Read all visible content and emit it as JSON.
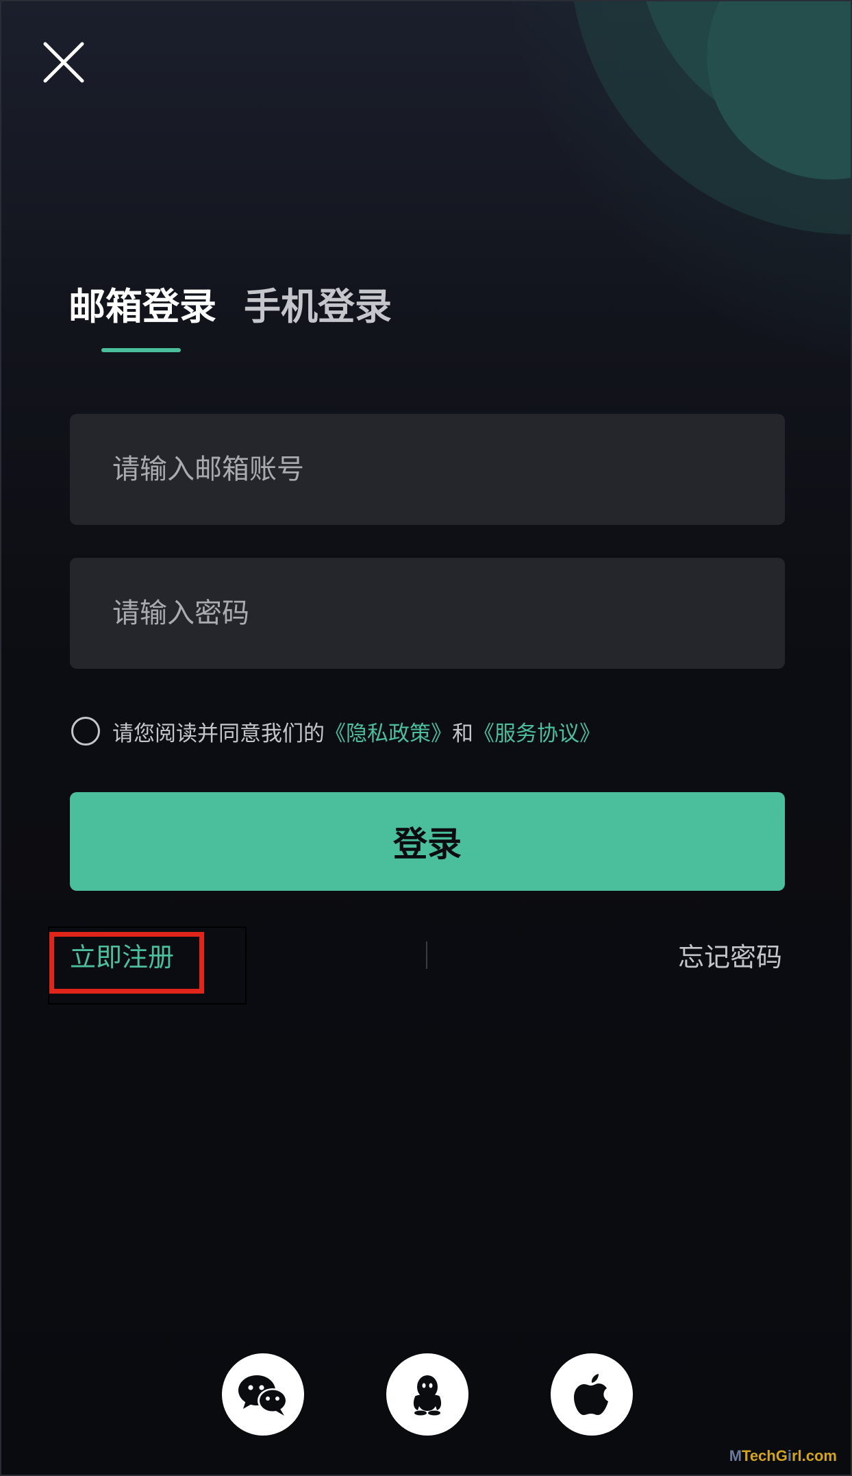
{
  "colors": {
    "accent": "#4bbf9c",
    "background": "#0b0c10",
    "field_background": "#25262b",
    "highlight_box": "#e0251b"
  },
  "header": {
    "close_icon": "close-icon"
  },
  "tabs": [
    {
      "label": "邮箱登录",
      "active": true
    },
    {
      "label": "手机登录",
      "active": false
    }
  ],
  "form": {
    "email_placeholder": "请输入邮箱账号",
    "password_placeholder": "请输入密码"
  },
  "agreement": {
    "prefix": "请您阅读并同意我们的",
    "privacy_link": "《隐私政策》",
    "conjunction": "和",
    "terms_link": "《服务协议》"
  },
  "login_button": "登录",
  "links": {
    "register": "立即注册",
    "forgot_password": "忘记密码"
  },
  "social_login": [
    {
      "name": "wechat",
      "icon": "wechat-icon"
    },
    {
      "name": "qq",
      "icon": "qq-icon"
    },
    {
      "name": "apple",
      "icon": "apple-icon"
    }
  ],
  "watermark": {
    "part1": "M",
    "part2": "TechG",
    "part3": "i",
    "part4": "rl.com"
  }
}
